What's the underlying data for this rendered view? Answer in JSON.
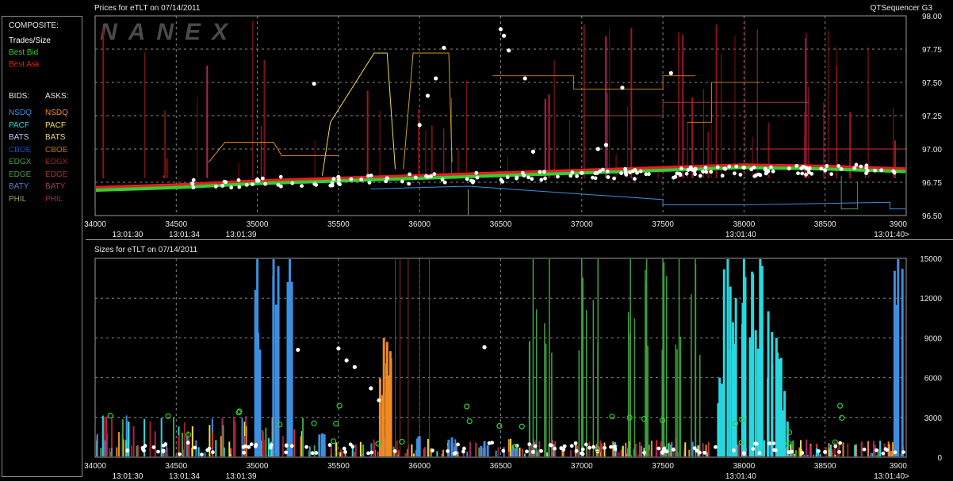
{
  "legend": {
    "composite_title": "COMPOSITE:",
    "composite": [
      {
        "label": "Trades/Size",
        "color": "#ffffff"
      },
      {
        "label": "Best Bid",
        "color": "#30d030"
      },
      {
        "label": "Best Ask",
        "color": "#e02020"
      }
    ],
    "bids_title": "BIDS:",
    "asks_title": "ASKS:",
    "exchanges": [
      {
        "bid": "NSDQ",
        "bid_color": "#3d8fe0",
        "ask": "NSDQ",
        "ask_color": "#f08a24"
      },
      {
        "bid": "PACF",
        "bid_color": "#28d8e0",
        "ask": "PACF",
        "ask_color": "#f0e040"
      },
      {
        "bid": "BATS",
        "bid_color": "#c8c8ff",
        "ask": "BATS",
        "ask_color": "#f0d080"
      },
      {
        "bid": "CBOE",
        "bid_color": "#2050c0",
        "ask": "CBOE",
        "ask_color": "#c07818"
      },
      {
        "bid": "EDGX",
        "bid_color": "#40a040",
        "ask": "EDGX",
        "ask_color": "#a02020"
      },
      {
        "bid": "EDGE",
        "bid_color": "#509850",
        "ask": "EDGE",
        "ask_color": "#b03030"
      },
      {
        "bid": "BATY",
        "bid_color": "#6080d0",
        "ask": "BATY",
        "ask_color": "#a04040"
      },
      {
        "bid": "PHIL",
        "bid_color": "#90a060",
        "ask": "PHIL",
        "ask_color": "#b02060"
      }
    ]
  },
  "header": {
    "sequencer": "QTSequencer G3"
  },
  "chart_data": [
    {
      "type": "line",
      "title": "Prices for  eTLT  on  07/14/2011",
      "watermark": "NANEX",
      "xlim": [
        34000,
        39000
      ],
      "ylim": [
        96.5,
        98.0
      ],
      "x_ticks": [
        34000,
        34500,
        35000,
        35500,
        36000,
        36500,
        37000,
        37500,
        38000,
        38500
      ],
      "x_tick_labels": [
        "34000",
        "34500",
        "35000",
        "35500",
        "36000",
        "36500",
        "37000",
        "37500",
        "38000",
        "38500",
        "3900"
      ],
      "y_ticks": [
        96.5,
        96.75,
        97.0,
        97.25,
        97.5,
        97.75,
        98.0
      ],
      "y_tick_labels": [
        "96.50",
        "96.75",
        "97.00",
        "97.25",
        "97.50",
        "97.75",
        "98.00"
      ],
      "time_labels": [
        {
          "x": 34200,
          "label": "13:01:30"
        },
        {
          "x": 34550,
          "label": "13:01:34"
        },
        {
          "x": 34900,
          "label": "13:01:39"
        },
        {
          "x": 37980,
          "label": "13:01:40"
        },
        {
          "x": 39000,
          "label": "13:01:40>"
        }
      ],
      "grid": true,
      "series": [
        {
          "name": "Best Ask",
          "color": "#e02020",
          "x": [
            34000,
            34500,
            35000,
            35500,
            36000,
            36500,
            37000,
            37500,
            38000,
            38500,
            39000
          ],
          "y": [
            96.71,
            96.73,
            96.76,
            96.78,
            96.8,
            96.82,
            96.84,
            96.86,
            96.88,
            96.87,
            96.85
          ]
        },
        {
          "name": "Best Bid",
          "color": "#30d030",
          "x": [
            34000,
            34500,
            35000,
            35500,
            36000,
            36500,
            37000,
            37500,
            38000,
            38500,
            39000
          ],
          "y": [
            96.69,
            96.71,
            96.74,
            96.76,
            96.78,
            96.8,
            96.82,
            96.84,
            96.86,
            96.85,
            96.83
          ]
        },
        {
          "name": "Trades/Size",
          "color": "#ffffff",
          "x": [
            34600,
            35000,
            35350,
            35500,
            35800,
            36000,
            36050,
            36100,
            36150,
            36500,
            36520,
            36550,
            36650,
            36700,
            37000,
            37100,
            37150,
            37250,
            37550,
            37700,
            38000,
            38500
          ],
          "y": [
            96.74,
            96.77,
            97.49,
            96.79,
            96.78,
            97.18,
            97.4,
            97.53,
            97.76,
            97.9,
            97.85,
            97.74,
            97.53,
            96.98,
            96.82,
            97.0,
            97.03,
            97.46,
            97.57,
            96.85,
            96.86,
            96.84
          ]
        }
      ]
    },
    {
      "type": "bar",
      "title": "Sizes for  eTLT  on  07/14/2011",
      "xlim": [
        34000,
        39000
      ],
      "ylim": [
        0,
        15000
      ],
      "x_ticks": [
        34000,
        34500,
        35000,
        35500,
        36000,
        36500,
        37000,
        37500,
        38000,
        38500
      ],
      "x_tick_labels": [
        "34000",
        "34500",
        "35000",
        "35500",
        "36000",
        "36500",
        "37000",
        "37500",
        "38000",
        "38500",
        "3900"
      ],
      "y_ticks": [
        0,
        3000,
        6000,
        9000,
        12000,
        15000
      ],
      "y_tick_labels": [
        "0",
        "3000",
        "6000",
        "9000",
        "12000",
        "15000"
      ],
      "time_labels": [
        {
          "x": 34200,
          "label": "13:01:30"
        },
        {
          "x": 34550,
          "label": "13:01:34"
        },
        {
          "x": 34900,
          "label": "13:01:39"
        },
        {
          "x": 37980,
          "label": "13:01:40"
        },
        {
          "x": 39000,
          "label": "13:01:40>"
        }
      ],
      "grid": true,
      "series": [
        {
          "name": "NSDQ",
          "color": "#3d8fe0",
          "x": [
            35000,
            35100,
            35200,
            35400,
            35800,
            36000,
            36200,
            36400,
            36600,
            38950
          ],
          "values": [
            15000,
            15000,
            15000,
            1800,
            3000,
            1600,
            1500,
            1200,
            800,
            15000
          ]
        },
        {
          "name": "PACF",
          "color": "#28d8e0",
          "x": [
            37850,
            37900,
            37950,
            38000,
            38050,
            38100,
            38150,
            38200,
            38250
          ],
          "values": [
            6000,
            15000,
            12000,
            15000,
            14000,
            15000,
            11000,
            9000,
            5000
          ]
        },
        {
          "name": "EDGX",
          "color": "#40a040",
          "x": [
            36700,
            36800,
            37000,
            37100,
            37300,
            37400,
            37500,
            37600,
            37700
          ],
          "values": [
            15000,
            15000,
            15000,
            15000,
            15000,
            15000,
            15000,
            15000,
            15000
          ]
        },
        {
          "name": "NSDQ",
          "color": "#f08a24",
          "x": [
            35780,
            35800,
            35820
          ],
          "values": [
            9000,
            8700,
            8000
          ]
        },
        {
          "name": "Trades/Size",
          "color": "#ffffff",
          "x": [
            34200,
            35250,
            35500,
            35550,
            35600,
            35700,
            35750,
            36400,
            36700,
            37000,
            37500,
            38000,
            38500
          ],
          "values": [
            500,
            8100,
            8200,
            7300,
            6800,
            5200,
            4300,
            8300,
            400,
            300,
            400,
            300,
            400
          ]
        }
      ]
    }
  ]
}
